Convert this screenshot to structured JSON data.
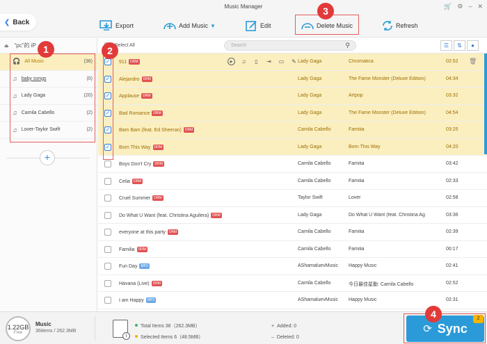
{
  "window": {
    "title": "Music Manager"
  },
  "toolbar": {
    "back": "Back",
    "export": "Export",
    "add_music": "Add Music",
    "edit": "Edit",
    "delete_music": "Delete Music",
    "refresh": "Refresh"
  },
  "device": {
    "label": "“pc”的 iP"
  },
  "playlists": [
    {
      "name": "All Music",
      "count": "(36)"
    },
    {
      "name": "baby songs",
      "count": "(0)"
    },
    {
      "name": "Lady Gaga",
      "count": "(20)"
    },
    {
      "name": "Camila Cabello",
      "count": "(2)"
    },
    {
      "name": "Lover-Taylor Swift",
      "count": "(2)"
    }
  ],
  "list": {
    "select_all": "Select All",
    "search_placeholder": "Search"
  },
  "tracks": [
    {
      "title": "911",
      "badge": "DRM",
      "artist": "Lady Gaga",
      "album": "Chromatica",
      "duration": "02:52",
      "selected": true
    },
    {
      "title": "Alejandro",
      "badge": "DRM",
      "artist": "Lady Gaga",
      "album": "The Fame Monster (Deluxe Edition)",
      "duration": "04:34",
      "selected": true
    },
    {
      "title": "Applause",
      "badge": "DRM",
      "artist": "Lady Gaga",
      "album": "Artpop",
      "duration": "03:32",
      "selected": true
    },
    {
      "title": "Bad Romance",
      "badge": "DRM",
      "artist": "Lady Gaga",
      "album": "The Fame Monster (Deluxe Edition)",
      "duration": "04:54",
      "selected": true
    },
    {
      "title": "Bam Bam (feat. Ed Sheeran)",
      "badge": "DRM",
      "artist": "Camila Cabello",
      "album": "Familia",
      "duration": "03:25",
      "selected": true
    },
    {
      "title": "Born This Way",
      "badge": "DRM",
      "artist": "Lady Gaga",
      "album": "Born This Way",
      "duration": "04:20",
      "selected": true
    },
    {
      "title": "Boys Don't Cry",
      "badge": "DRM",
      "artist": "Camila Cabello",
      "album": "Familia",
      "duration": "03:42",
      "selected": false
    },
    {
      "title": "Celia",
      "badge": "DRM",
      "artist": "Camila Cabello",
      "album": "Familia",
      "duration": "02:33",
      "selected": false
    },
    {
      "title": "Cruel Summer",
      "badge": "DRM",
      "artist": "Taylor Swift",
      "album": "Lover",
      "duration": "02:58",
      "selected": false
    },
    {
      "title": "Do What U Want (feat. Christina Aguilera)",
      "badge": "DRM",
      "artist": "Lady Gaga",
      "album": "Do What U Want (feat. Christina Ag",
      "duration": "03:36",
      "selected": false
    },
    {
      "title": "everyone at this party",
      "badge": "DRM",
      "artist": "Camila Cabello",
      "album": "Familia",
      "duration": "02:39",
      "selected": false
    },
    {
      "title": "Familia",
      "badge": "DRM",
      "artist": "Camila Cabello",
      "album": "Familia",
      "duration": "00:17",
      "selected": false
    },
    {
      "title": "Fun Day",
      "badge": "MP3",
      "artist": "AShamaluevMusic",
      "album": "Happy Music",
      "duration": "02:41",
      "selected": false
    },
    {
      "title": "Havana (Live)",
      "badge": "DRM",
      "artist": "Camila Cabello",
      "album": "今日最佳星動: Camila Cabello",
      "duration": "02:52",
      "selected": false
    },
    {
      "title": "I am Happy",
      "badge": "MP3",
      "artist": "AShamaluevMusic",
      "album": "Happy Music",
      "duration": "02:31",
      "selected": false
    }
  ],
  "storage": {
    "capacity": "1.22GB",
    "free_label": "Free",
    "type": "Music",
    "detail": "36items / 262.3MB"
  },
  "stats": {
    "total": "Total Items 36（262.3MB）",
    "selected": "Selected Items 6（48.5MB）",
    "added": "Added: 0",
    "deleted": "Deleted: 0"
  },
  "sync": {
    "label": "Sync",
    "badge": "2"
  },
  "annotations": [
    "1",
    "2",
    "3",
    "4"
  ],
  "colors": {
    "accent": "#2a9bd8",
    "selected_row": "#fbefc0",
    "annotation": "#e23a3a",
    "drm_badge": "#e05252",
    "mp3_badge": "#6aa8e8"
  }
}
